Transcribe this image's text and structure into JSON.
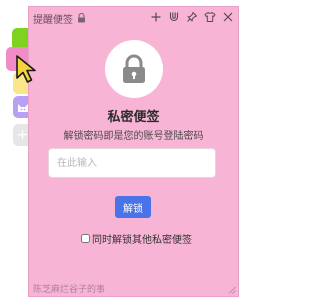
{
  "colors": {
    "note_background": "#f7b4d5",
    "accent_button": "#4a73e8",
    "tab_green": "#7ed321",
    "tab_pink": "#f08dc6",
    "tab_yellow": "#fbe58a",
    "tab_purple": "#b8a1f5",
    "tab_add": "#e6e6e6"
  },
  "sidebar": {
    "tabs": [
      {
        "color": "#7ed321",
        "icon": "none"
      },
      {
        "color": "#f08dc6",
        "icon": "none"
      },
      {
        "color": "#fbe58a",
        "icon": "none"
      },
      {
        "color": "#b8a1f5",
        "icon": "cat-icon"
      },
      {
        "color": "#e6e6e6",
        "icon": "plus-icon",
        "label": "+"
      }
    ]
  },
  "titlebar": {
    "title": "提醒便签",
    "icons": [
      "lock-icon",
      "plus-icon",
      "magnet-icon",
      "pin-icon",
      "shirt-icon",
      "close-icon"
    ]
  },
  "lock_screen": {
    "icon": "padlock-icon",
    "heading": "私密便签",
    "subtitle": "解锁密码即是您的账号登陆密码",
    "password_placeholder": "在此输入",
    "password_value": "",
    "unlock_label": "解锁",
    "unlock_all_label": "同时解锁其他私密便签",
    "unlock_all_checked": false
  },
  "footer": {
    "text": "陈芝麻烂谷子的事"
  }
}
